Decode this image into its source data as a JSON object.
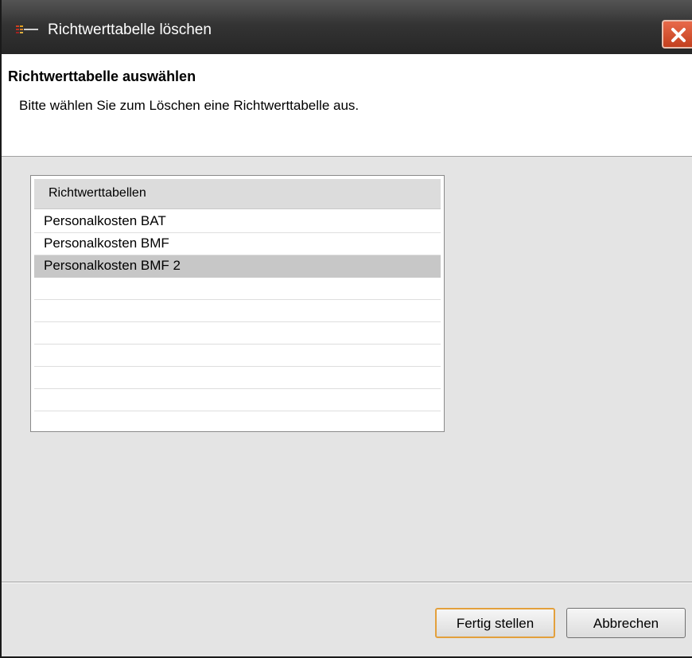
{
  "window": {
    "title": "Richtwerttabelle löschen",
    "icon": "table-delete-icon",
    "close_icon": "close-icon"
  },
  "header": {
    "title": "Richtwerttabelle auswählen",
    "description": "Bitte wählen Sie zum Löschen eine Richtwerttabelle aus."
  },
  "table": {
    "column_header": "Richtwerttabellen",
    "rows": [
      {
        "label": "Personalkosten BAT",
        "selected": false
      },
      {
        "label": "Personalkosten BMF",
        "selected": false
      },
      {
        "label": "Personalkosten BMF 2",
        "selected": true
      }
    ]
  },
  "buttons": {
    "finish": "Fertig stellen",
    "cancel": "Abbrechen"
  },
  "colors": {
    "titlebar": "#343434",
    "close_button": "#d4542f",
    "selection": "#c7c7c7",
    "default_button_border": "#e3a03c"
  }
}
